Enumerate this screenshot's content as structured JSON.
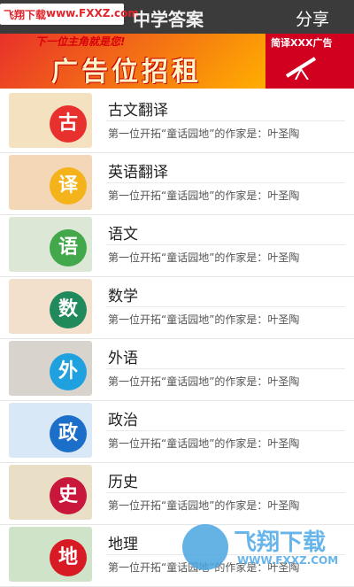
{
  "header": {
    "title": "中学答案",
    "share_label": "分享",
    "watermark_brand": "飞翔下载",
    "watermark_url": "www.FXXZ.com"
  },
  "banner": {
    "slogan": "下一位主角就是您!",
    "headline": "广告位招租",
    "right_text": "简译XXX广告"
  },
  "items": [
    {
      "title": "古文翻译",
      "desc": "第一位开拓“童话园地”的作家是：叶圣陶",
      "char": "古",
      "color": "#e8312f",
      "bg": "#f4e1c0"
    },
    {
      "title": "英语翻译",
      "desc": "第一位开拓“童话园地”的作家是：叶圣陶",
      "char": "译",
      "color": "#f4b21b",
      "bg": "#f3d7b7"
    },
    {
      "title": "语文",
      "desc": "第一位开拓“童话园地”的作家是：叶圣陶",
      "char": "语",
      "color": "#42a84b",
      "bg": "#dce7d6"
    },
    {
      "title": "数学",
      "desc": "第一位开拓“童话园地”的作家是：叶圣陶",
      "char": "数",
      "color": "#208a5c",
      "bg": "#f2e0cd"
    },
    {
      "title": "外语",
      "desc": "第一位开拓“童话园地”的作家是：叶圣陶",
      "char": "外",
      "color": "#1fa1e0",
      "bg": "#d8d3cc"
    },
    {
      "title": "政治",
      "desc": "第一位开拓“童话园地”的作家是：叶圣陶",
      "char": "政",
      "color": "#1c6fc9",
      "bg": "#d8e8f6"
    },
    {
      "title": "历史",
      "desc": "第一位开拓“童话园地”的作家是：叶圣陶",
      "char": "史",
      "color": "#c9173b",
      "bg": "#e9dfc6"
    },
    {
      "title": "地理",
      "desc": "第一位开拓“童话园地”的作家是：叶圣陶",
      "char": "地",
      "color": "#d71a24",
      "bg": "#cfe3c9"
    }
  ],
  "bottom_watermark": {
    "brand": "飞翔下载",
    "url": "WWW.FXXZ.COM"
  }
}
